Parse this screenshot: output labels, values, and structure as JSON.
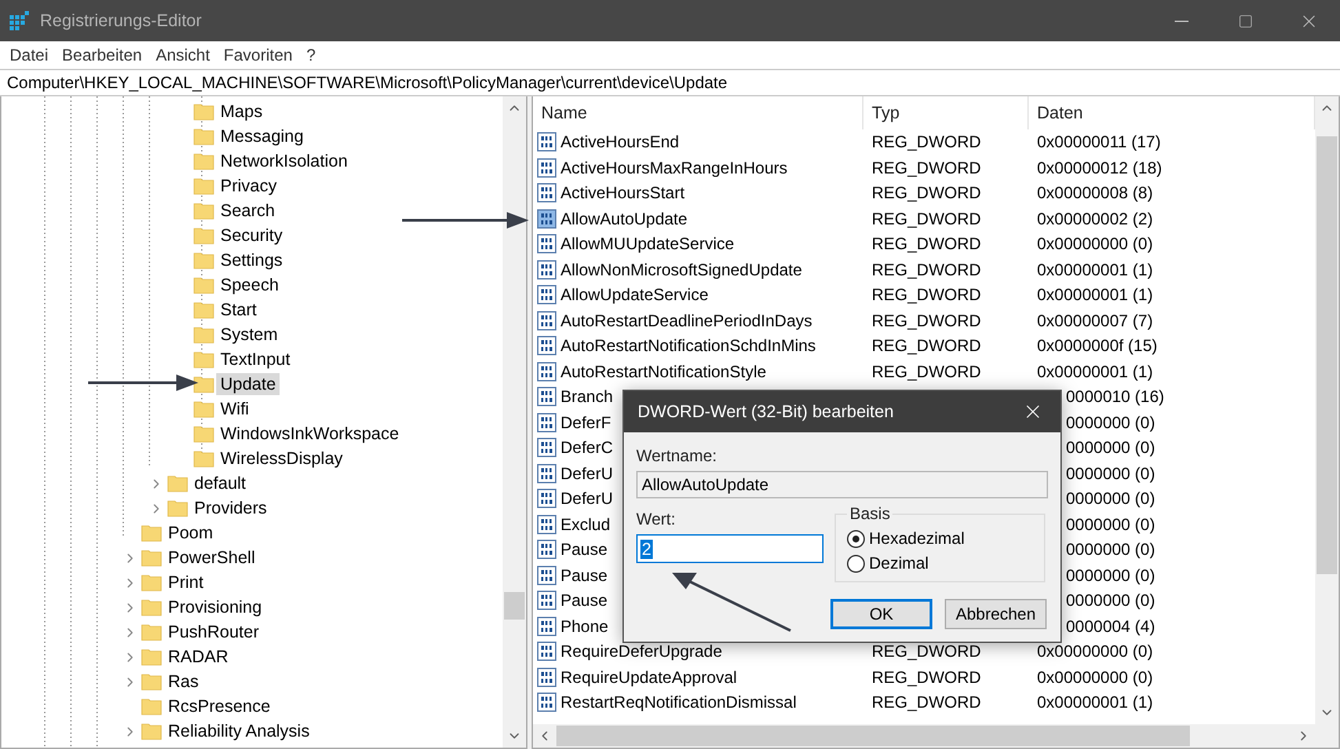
{
  "window": {
    "title": "Registrierungs-Editor"
  },
  "menu": [
    "Datei",
    "Bearbeiten",
    "Ansicht",
    "Favoriten",
    "?"
  ],
  "address": "Computer\\HKEY_LOCAL_MACHINE\\SOFTWARE\\Microsoft\\PolicyManager\\current\\device\\Update",
  "tree": [
    {
      "children": [
        {
          "children": [
            {
              "label": "Maps",
              "expandable": false,
              "selected": false
            },
            {
              "label": "Messaging",
              "expandable": false,
              "selected": false
            },
            {
              "label": "NetworkIsolation",
              "expandable": false,
              "selected": false
            },
            {
              "label": "Privacy",
              "expandable": false,
              "selected": false
            },
            {
              "label": "Search",
              "expandable": false,
              "selected": false
            },
            {
              "label": "Security",
              "expandable": false,
              "selected": false
            },
            {
              "label": "Settings",
              "expandable": false,
              "selected": false
            },
            {
              "label": "Speech",
              "expandable": false,
              "selected": false
            },
            {
              "label": "Start",
              "expandable": false,
              "selected": false
            },
            {
              "label": "System",
              "expandable": false,
              "selected": false
            },
            {
              "label": "TextInput",
              "expandable": false,
              "selected": false
            },
            {
              "label": "Update",
              "expandable": false,
              "selected": true
            },
            {
              "label": "Wifi",
              "expandable": false,
              "selected": false
            },
            {
              "label": "WindowsInkWorkspace",
              "expandable": false,
              "selected": false
            },
            {
              "label": "WirelessDisplay",
              "expandable": false,
              "selected": false
            }
          ]
        },
        {
          "label": "default",
          "expandable": true,
          "selected": false
        },
        {
          "label": "Providers",
          "expandable": true,
          "selected": false
        }
      ]
    },
    {
      "label": "Poom",
      "expandable": false,
      "selected": false
    },
    {
      "label": "PowerShell",
      "expandable": true,
      "selected": false
    },
    {
      "label": "Print",
      "expandable": true,
      "selected": false
    },
    {
      "label": "Provisioning",
      "expandable": true,
      "selected": false
    },
    {
      "label": "PushRouter",
      "expandable": true,
      "selected": false
    },
    {
      "label": "RADAR",
      "expandable": true,
      "selected": false
    },
    {
      "label": "Ras",
      "expandable": true,
      "selected": false
    },
    {
      "label": "RcsPresence",
      "expandable": false,
      "selected": false
    },
    {
      "label": "Reliability Analysis",
      "expandable": true,
      "selected": false
    }
  ],
  "table": {
    "columns": [
      "Name",
      "Typ",
      "Daten"
    ],
    "rows": [
      {
        "kind": "full",
        "name": "ActiveHoursEnd",
        "type": "REG_DWORD",
        "data": "0x00000011 (17)",
        "selected": false
      },
      {
        "kind": "full",
        "name": "ActiveHoursMaxRangeInHours",
        "type": "REG_DWORD",
        "data": "0x00000012 (18)",
        "selected": false
      },
      {
        "kind": "full",
        "name": "ActiveHoursStart",
        "type": "REG_DWORD",
        "data": "0x00000008 (8)",
        "selected": false
      },
      {
        "kind": "full",
        "name": "AllowAutoUpdate",
        "type": "REG_DWORD",
        "data": "0x00000002 (2)",
        "selected": true
      },
      {
        "kind": "full",
        "name": "AllowMUUpdateService",
        "type": "REG_DWORD",
        "data": "0x00000000 (0)",
        "selected": false
      },
      {
        "kind": "full",
        "name": "AllowNonMicrosoftSignedUpdate",
        "type": "REG_DWORD",
        "data": "0x00000001 (1)",
        "selected": false
      },
      {
        "kind": "full",
        "name": "AllowUpdateService",
        "type": "REG_DWORD",
        "data": "0x00000001 (1)",
        "selected": false
      },
      {
        "kind": "full",
        "name": "AutoRestartDeadlinePeriodInDays",
        "type": "REG_DWORD",
        "data": "0x00000007 (7)",
        "selected": false
      },
      {
        "kind": "full",
        "name": "AutoRestartNotificationSchdInMins",
        "type": "REG_DWORD",
        "data": "0x0000000f (15)",
        "selected": false
      },
      {
        "kind": "full",
        "name": "AutoRestartNotificationStyle",
        "type": "REG_DWORD",
        "data": "0x00000001 (1)",
        "selected": false
      },
      {
        "kind": "covered",
        "name": "Branch",
        "data": "0000010 (16)",
        "selected": false
      },
      {
        "kind": "covered",
        "name": "DeferF",
        "data": "0000000 (0)",
        "selected": false
      },
      {
        "kind": "covered",
        "name": "DeferC",
        "data": "0000000 (0)",
        "selected": false
      },
      {
        "kind": "covered",
        "name": "DeferU",
        "data": "0000000 (0)",
        "selected": false
      },
      {
        "kind": "covered",
        "name": "DeferU",
        "data": "0000000 (0)",
        "selected": false
      },
      {
        "kind": "covered",
        "name": "Exclud",
        "data": "0000000 (0)",
        "selected": false
      },
      {
        "kind": "covered",
        "name": "Pause",
        "data": "0000000 (0)",
        "selected": false
      },
      {
        "kind": "covered",
        "name": "Pause",
        "data": "0000000 (0)",
        "selected": false
      },
      {
        "kind": "covered",
        "name": "Pause",
        "data": "0000000 (0)",
        "selected": false
      },
      {
        "kind": "covered",
        "name": "Phone",
        "data": "0000004 (4)",
        "selected": false
      },
      {
        "kind": "full",
        "name": "RequireDeferUpgrade",
        "type": "REG_DWORD",
        "data": "0x00000000 (0)",
        "selected": false
      },
      {
        "kind": "full",
        "name": "RequireUpdateApproval",
        "type": "REG_DWORD",
        "data": "0x00000000 (0)",
        "selected": false
      },
      {
        "kind": "full",
        "name": "RestartReqNotificationDismissal",
        "type": "REG_DWORD",
        "data": "0x00000001 (1)",
        "selected": false
      }
    ]
  },
  "dialog": {
    "title": "DWORD-Wert (32-Bit) bearbeiten",
    "name_label": "Wertname:",
    "name_value": "AllowAutoUpdate",
    "value_label": "Wert:",
    "value": "2",
    "base_label": "Basis",
    "bases": [
      {
        "label": "Hexadezimal",
        "selected": true
      },
      {
        "label": "Dezimal",
        "selected": false
      }
    ],
    "buttons": [
      {
        "label": "OK",
        "default": true
      },
      {
        "label": "Abbrechen",
        "default": false
      }
    ]
  }
}
